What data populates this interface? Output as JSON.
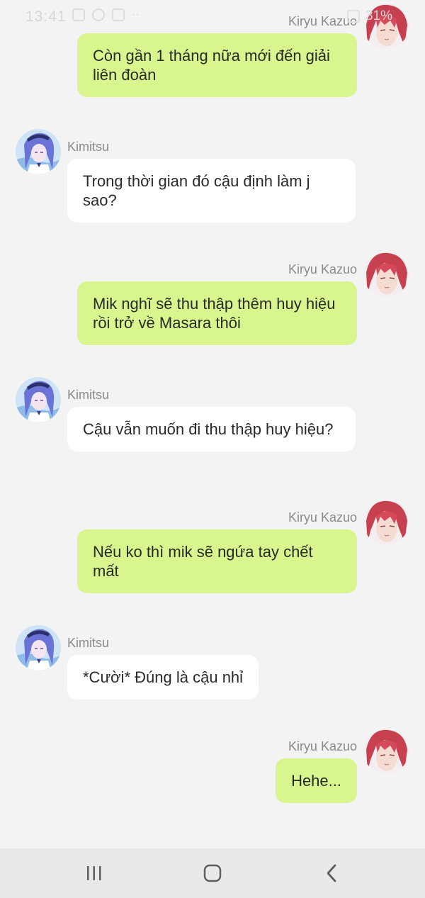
{
  "status_bar": {
    "time": "13:41",
    "battery": "31%"
  },
  "messages": [
    {
      "side": "right",
      "sender": "Kiryu Kazuo",
      "text": "Còn gần 1 tháng nữa mới đến giải liên đoàn"
    },
    {
      "side": "left",
      "sender": "Kimitsu",
      "text": "Trong thời gian đó cậu định làm j sao?"
    },
    {
      "side": "right",
      "sender": "Kiryu Kazuo",
      "text": "Mik nghĩ sẽ thu thập thêm huy hiệu rồi trở về Masara thôi"
    },
    {
      "side": "left",
      "sender": "Kimitsu",
      "text": "Cậu vẫn muốn đi thu thập huy hiệu?"
    },
    {
      "side": "right",
      "sender": "Kiryu Kazuo",
      "text": "Nếu ko thì mik sẽ ngứa tay chết mất"
    },
    {
      "side": "left",
      "sender": "Kimitsu",
      "text": "*Cười* Đúng là cậu nhỉ"
    },
    {
      "side": "right",
      "sender": "Kiryu Kazuo",
      "text": "Hehe..."
    }
  ],
  "nav": {
    "recents_icon": "recent-apps-icon",
    "home_icon": "home-icon",
    "back_icon": "back-icon"
  },
  "colors": {
    "right_bubble": "#d8f58e",
    "left_bubble": "#ffffff",
    "background": "#f3f3f3"
  }
}
